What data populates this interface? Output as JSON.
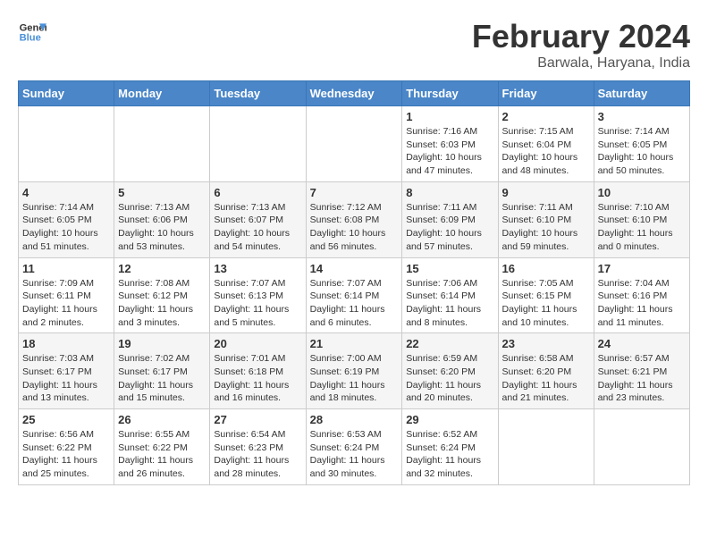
{
  "header": {
    "logo_line1": "General",
    "logo_line2": "Blue",
    "title": "February 2024",
    "subtitle": "Barwala, Haryana, India"
  },
  "days_of_week": [
    "Sunday",
    "Monday",
    "Tuesday",
    "Wednesday",
    "Thursday",
    "Friday",
    "Saturday"
  ],
  "weeks": [
    [
      {
        "day": null
      },
      {
        "day": null
      },
      {
        "day": null
      },
      {
        "day": null
      },
      {
        "day": 1,
        "sunrise": "7:16 AM",
        "sunset": "6:03 PM",
        "daylight": "10 hours and 47 minutes."
      },
      {
        "day": 2,
        "sunrise": "7:15 AM",
        "sunset": "6:04 PM",
        "daylight": "10 hours and 48 minutes."
      },
      {
        "day": 3,
        "sunrise": "7:14 AM",
        "sunset": "6:05 PM",
        "daylight": "10 hours and 50 minutes."
      }
    ],
    [
      {
        "day": 4,
        "sunrise": "7:14 AM",
        "sunset": "6:05 PM",
        "daylight": "10 hours and 51 minutes."
      },
      {
        "day": 5,
        "sunrise": "7:13 AM",
        "sunset": "6:06 PM",
        "daylight": "10 hours and 53 minutes."
      },
      {
        "day": 6,
        "sunrise": "7:13 AM",
        "sunset": "6:07 PM",
        "daylight": "10 hours and 54 minutes."
      },
      {
        "day": 7,
        "sunrise": "7:12 AM",
        "sunset": "6:08 PM",
        "daylight": "10 hours and 56 minutes."
      },
      {
        "day": 8,
        "sunrise": "7:11 AM",
        "sunset": "6:09 PM",
        "daylight": "10 hours and 57 minutes."
      },
      {
        "day": 9,
        "sunrise": "7:11 AM",
        "sunset": "6:10 PM",
        "daylight": "10 hours and 59 minutes."
      },
      {
        "day": 10,
        "sunrise": "7:10 AM",
        "sunset": "6:10 PM",
        "daylight": "11 hours and 0 minutes."
      }
    ],
    [
      {
        "day": 11,
        "sunrise": "7:09 AM",
        "sunset": "6:11 PM",
        "daylight": "11 hours and 2 minutes."
      },
      {
        "day": 12,
        "sunrise": "7:08 AM",
        "sunset": "6:12 PM",
        "daylight": "11 hours and 3 minutes."
      },
      {
        "day": 13,
        "sunrise": "7:07 AM",
        "sunset": "6:13 PM",
        "daylight": "11 hours and 5 minutes."
      },
      {
        "day": 14,
        "sunrise": "7:07 AM",
        "sunset": "6:14 PM",
        "daylight": "11 hours and 6 minutes."
      },
      {
        "day": 15,
        "sunrise": "7:06 AM",
        "sunset": "6:14 PM",
        "daylight": "11 hours and 8 minutes."
      },
      {
        "day": 16,
        "sunrise": "7:05 AM",
        "sunset": "6:15 PM",
        "daylight": "11 hours and 10 minutes."
      },
      {
        "day": 17,
        "sunrise": "7:04 AM",
        "sunset": "6:16 PM",
        "daylight": "11 hours and 11 minutes."
      }
    ],
    [
      {
        "day": 18,
        "sunrise": "7:03 AM",
        "sunset": "6:17 PM",
        "daylight": "11 hours and 13 minutes."
      },
      {
        "day": 19,
        "sunrise": "7:02 AM",
        "sunset": "6:17 PM",
        "daylight": "11 hours and 15 minutes."
      },
      {
        "day": 20,
        "sunrise": "7:01 AM",
        "sunset": "6:18 PM",
        "daylight": "11 hours and 16 minutes."
      },
      {
        "day": 21,
        "sunrise": "7:00 AM",
        "sunset": "6:19 PM",
        "daylight": "11 hours and 18 minutes."
      },
      {
        "day": 22,
        "sunrise": "6:59 AM",
        "sunset": "6:20 PM",
        "daylight": "11 hours and 20 minutes."
      },
      {
        "day": 23,
        "sunrise": "6:58 AM",
        "sunset": "6:20 PM",
        "daylight": "11 hours and 21 minutes."
      },
      {
        "day": 24,
        "sunrise": "6:57 AM",
        "sunset": "6:21 PM",
        "daylight": "11 hours and 23 minutes."
      }
    ],
    [
      {
        "day": 25,
        "sunrise": "6:56 AM",
        "sunset": "6:22 PM",
        "daylight": "11 hours and 25 minutes."
      },
      {
        "day": 26,
        "sunrise": "6:55 AM",
        "sunset": "6:22 PM",
        "daylight": "11 hours and 26 minutes."
      },
      {
        "day": 27,
        "sunrise": "6:54 AM",
        "sunset": "6:23 PM",
        "daylight": "11 hours and 28 minutes."
      },
      {
        "day": 28,
        "sunrise": "6:53 AM",
        "sunset": "6:24 PM",
        "daylight": "11 hours and 30 minutes."
      },
      {
        "day": 29,
        "sunrise": "6:52 AM",
        "sunset": "6:24 PM",
        "daylight": "11 hours and 32 minutes."
      },
      {
        "day": null
      },
      {
        "day": null
      }
    ]
  ]
}
